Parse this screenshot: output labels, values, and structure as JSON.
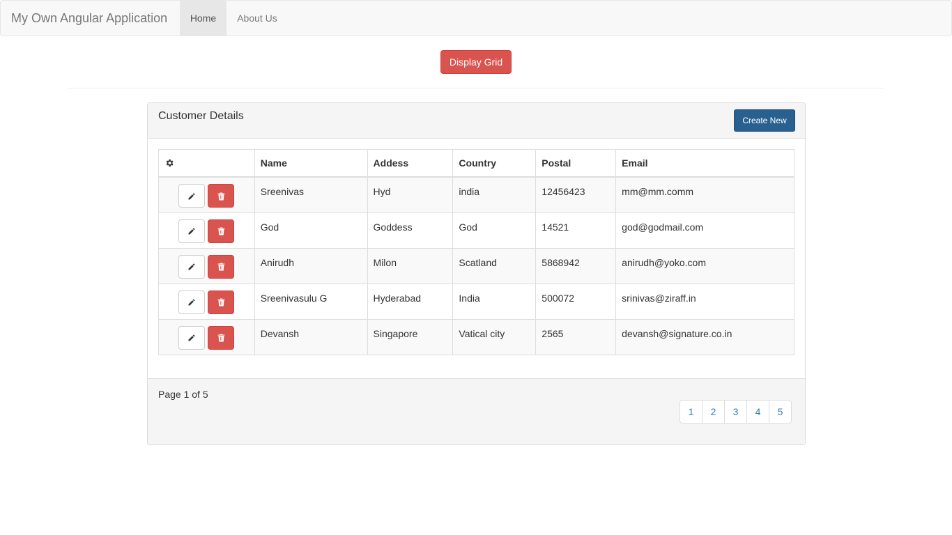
{
  "navbar": {
    "brand": "My Own Angular Application",
    "links": [
      "Home",
      "About Us"
    ],
    "active": "Home"
  },
  "display_button": "Display Grid",
  "panel": {
    "title": "Customer Details",
    "create_button": "Create New"
  },
  "table": {
    "settings_icon": "gear-icon",
    "headers": [
      "Name",
      "Addess",
      "Country",
      "Postal",
      "Email"
    ],
    "edit_icon": "pencil-icon",
    "delete_icon": "trash-icon",
    "rows": [
      [
        "Sreenivas",
        "Hyd",
        "india",
        "12456423",
        "mm@mm.comm"
      ],
      [
        "God",
        "Goddess",
        "God",
        "14521",
        "god@godmail.com"
      ],
      [
        "Anirudh",
        "Milon",
        "Scatland",
        "5868942",
        "anirudh@yoko.com"
      ],
      [
        "Sreenivasulu G",
        "Hyderabad",
        "India",
        "500072",
        "srinivas@ziraff.in"
      ],
      [
        "Devansh",
        "Singapore",
        "Vatical city",
        "2565",
        "devansh@signature.co.in"
      ]
    ]
  },
  "footer": {
    "page_info": "Page 1 of 5",
    "pages": [
      "1",
      "2",
      "3",
      "4",
      "5"
    ]
  },
  "colors": {
    "danger": "#d9534f",
    "primary": "#286090",
    "link": "#337ab7",
    "navbar_bg": "#f8f8f8"
  }
}
